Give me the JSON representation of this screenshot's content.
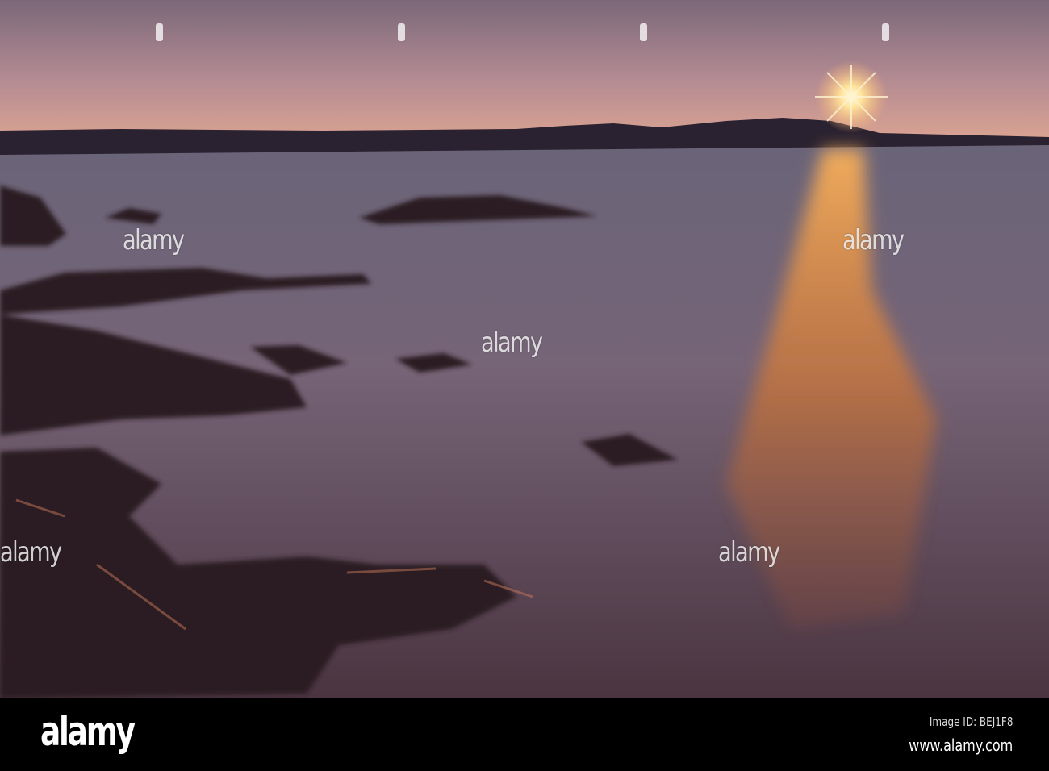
{
  "watermark": {
    "text": "alamy"
  },
  "footer": {
    "logo": "alamy",
    "image_id": "Image ID: BEJ1F8",
    "site": "www.alamy.com"
  },
  "colors": {
    "sky_top": "#7d6a78",
    "horizon": "#e8a98e",
    "water": "#6f6678",
    "sun": "#fff4c8",
    "reflection": "#f08a2a"
  }
}
